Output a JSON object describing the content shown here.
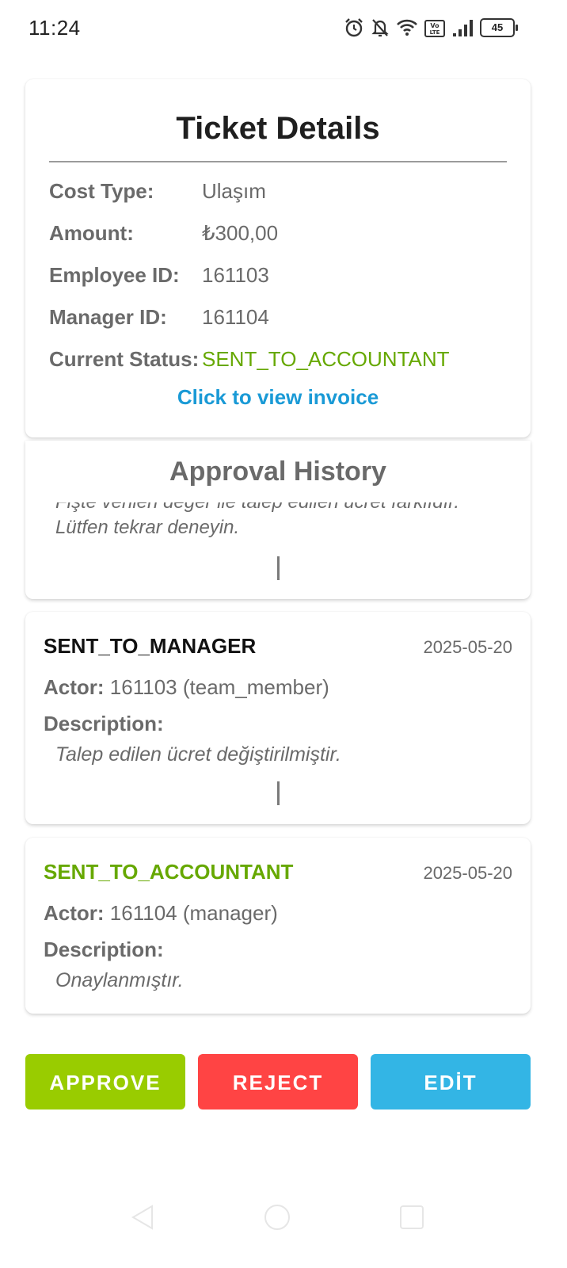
{
  "status_bar": {
    "time": "11:24",
    "battery": "45",
    "icons": [
      "alarm-icon",
      "bell-off-icon",
      "wifi-icon",
      "volte-icon",
      "signal-icon",
      "battery-icon"
    ]
  },
  "details": {
    "title": "Ticket Details",
    "rows": [
      {
        "label": "Cost Type:",
        "value": "Ulaşım"
      },
      {
        "label": "Amount:",
        "value": "₺300,00"
      },
      {
        "label": "Employee ID:",
        "value": "161103"
      },
      {
        "label": "Manager ID:",
        "value": "161104"
      },
      {
        "label": "Current Status:",
        "value": "SENT_TO_ACCOUNTANT"
      }
    ],
    "invoice_link": "Click to view invoice"
  },
  "history": {
    "title": "Approval History",
    "partial_description": "Fişte verilen değer ile talep edilen ücret farklıdır. Lütfen tekrar deneyin.",
    "entries": [
      {
        "status": "SENT_TO_MANAGER",
        "date": "2025-05-20",
        "actor_label": "Actor:",
        "actor": "161103 (team_member)",
        "description_label": "Description:",
        "description": "Talep edilen ücret değiştirilmiştir."
      },
      {
        "status": "SENT_TO_ACCOUNTANT",
        "date": "2025-05-20",
        "actor_label": "Actor:",
        "actor": "161104 (manager)",
        "description_label": "Description:",
        "description": "Onaylanmıştır."
      }
    ]
  },
  "actions": {
    "approve": "APPROVE",
    "reject": "REJECT",
    "edit": "EDİT"
  },
  "colors": {
    "approve": "#99cc00",
    "reject": "#ff4444",
    "edit": "#33b5e5",
    "status_green": "#66a800",
    "link_blue": "#1a9ad6"
  },
  "nav_icons": [
    "back-icon",
    "home-icon",
    "recents-icon"
  ]
}
